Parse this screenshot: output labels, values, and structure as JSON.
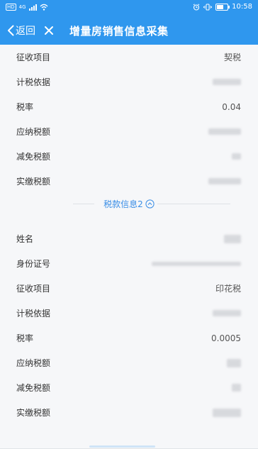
{
  "status_bar": {
    "network_badge": "HD",
    "network_type": "4G",
    "time": "10:58"
  },
  "nav": {
    "back_label": "返回",
    "title": "增量房销售信息采集"
  },
  "section1": {
    "rows": [
      {
        "label": "征收项目",
        "value": "契税"
      },
      {
        "label": "计税依据",
        "value": ""
      },
      {
        "label": "税率",
        "value": "0.04"
      },
      {
        "label": "应纳税额",
        "value": ""
      },
      {
        "label": "减免税额",
        "value": ""
      },
      {
        "label": "实缴税额",
        "value": ""
      }
    ]
  },
  "section2": {
    "toggle_label": "税款信息2",
    "rows": [
      {
        "label": "姓名",
        "value": ""
      },
      {
        "label": "身份证号",
        "value": ""
      },
      {
        "label": "征收项目",
        "value": "印花税"
      },
      {
        "label": "计税依据",
        "value": ""
      },
      {
        "label": "税率",
        "value": "0.0005"
      },
      {
        "label": "应纳税额",
        "value": ""
      },
      {
        "label": "减免税额",
        "value": ""
      },
      {
        "label": "实缴税额",
        "value": ""
      }
    ]
  },
  "colors": {
    "header": "#2f97ee",
    "accent": "#3a8ee6",
    "background": "#f6f7f9"
  },
  "icons": [
    "back-arrow-icon",
    "close-icon",
    "chevron-up-circle-icon",
    "alarm-icon",
    "vibrate-icon",
    "battery-icon",
    "signal-icon",
    "wifi-icon"
  ]
}
